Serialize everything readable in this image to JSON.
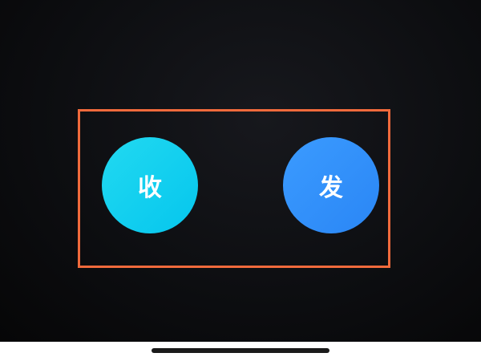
{
  "buttons": {
    "receive": {
      "label": "收",
      "gradient": [
        "#22d9f0",
        "#05c6ee"
      ]
    },
    "send": {
      "label": "发",
      "gradient": [
        "#3b9bff",
        "#2a86f5"
      ]
    }
  },
  "colors": {
    "highlight_border": "#f06a3c",
    "background": "#0d0e11",
    "home_indicator": "#1a1a1a"
  }
}
